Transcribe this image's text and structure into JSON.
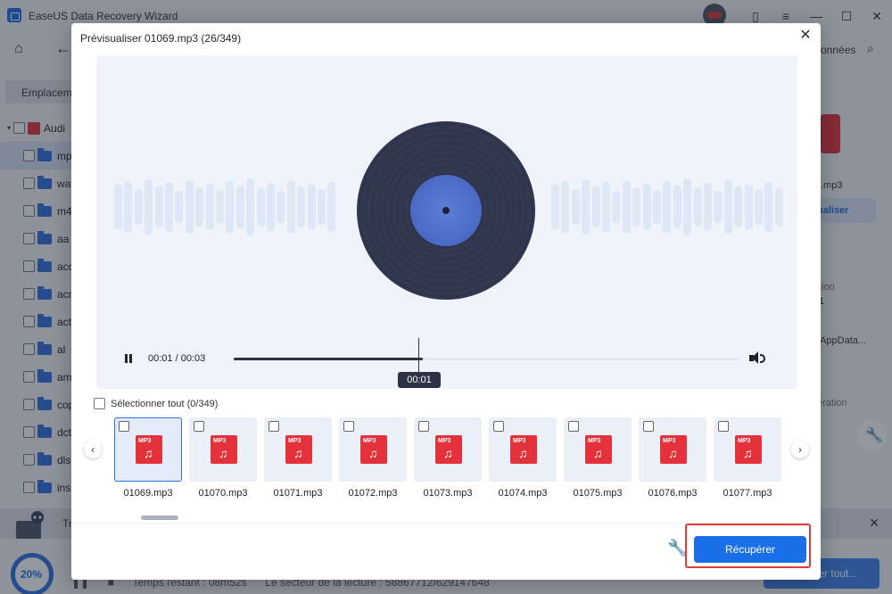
{
  "app": {
    "title": "EaseUS Data Recovery Wizard",
    "search_label": "onnées",
    "tab_label": "Emplaceme",
    "tree": {
      "root_label": "Audi",
      "children": [
        "mp3",
        "wav",
        "m4a",
        "aa",
        "acc",
        "acm",
        "act",
        "al",
        "amr",
        "cop",
        "dct",
        "dls",
        "ins"
      ]
    },
    "right_panel": {
      "file_label": ".mp3",
      "preview_btn": "ualiser",
      "line1": "tion",
      "line2": "1",
      "line3": "\\AppData...",
      "line4": "ération"
    },
    "bottom": {
      "strip_label": "Tr",
      "progress": "20%",
      "status_time": "Temps restant : 08m52s",
      "status_sector": "Le secteur de la lecture : 58867712/629147648",
      "recover_all": "Récupérer tout..."
    }
  },
  "modal": {
    "title": "Prévisualiser 01069.mp3 (26/349)",
    "player": {
      "time": "00:01 / 00:03",
      "tooltip": "00:01",
      "progress_fraction": 0.375
    },
    "select_all": "Sélectionner tout (0/349)",
    "thumbnails": [
      {
        "name": "01069.mp3",
        "tag": "MP3",
        "selected": true
      },
      {
        "name": "01070.mp3",
        "tag": "MP3",
        "selected": false
      },
      {
        "name": "01071.mp3",
        "tag": "MP3",
        "selected": false
      },
      {
        "name": "01072.mp3",
        "tag": "MP3",
        "selected": false
      },
      {
        "name": "01073.mp3",
        "tag": "MP3",
        "selected": false
      },
      {
        "name": "01074.mp3",
        "tag": "MP3",
        "selected": false
      },
      {
        "name": "01075.mp3",
        "tag": "MP3",
        "selected": false
      },
      {
        "name": "01076.mp3",
        "tag": "MP3",
        "selected": false
      },
      {
        "name": "01077.mp3",
        "tag": "MP3",
        "selected": false
      }
    ],
    "recover_button": "Récupérer"
  },
  "colors": {
    "accent": "#1a6ee8",
    "file_icon": "#e3323b",
    "highlight": "#e03a3a"
  }
}
